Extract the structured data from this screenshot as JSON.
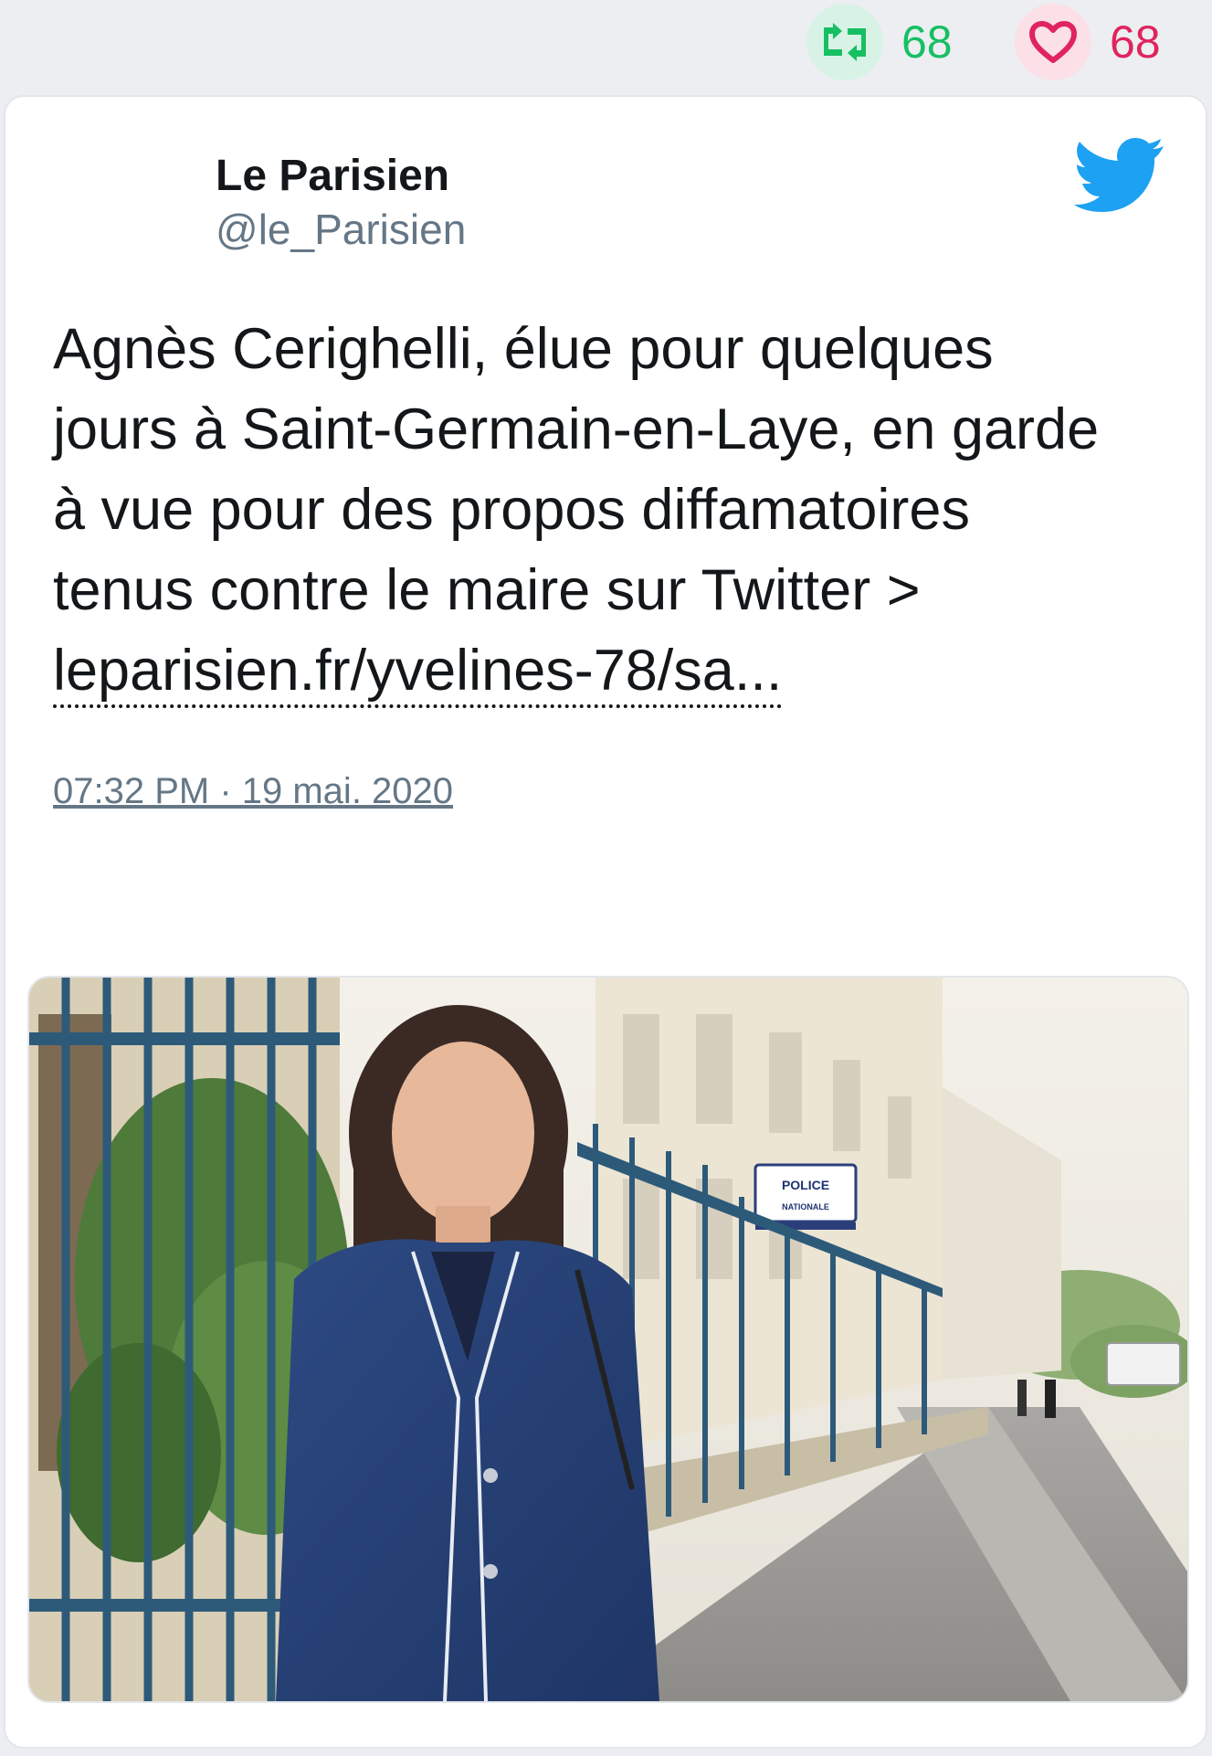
{
  "stats": {
    "retweets": "68",
    "likes": "68"
  },
  "author": {
    "name": "Le Parisien",
    "handle": "@le_Parisien"
  },
  "tweet": {
    "text_lines": [
      "Agnès Cerighelli, élue pour quelques",
      "jours à Saint-Germain-en-Laye, en garde",
      "à vue pour des propos diffamatoires",
      "tenus contre le maire sur Twitter >"
    ],
    "link": "leparisien.fr/yvelines-78/sa...",
    "timestamp": "07:32 PM · 19 mai. 2020"
  },
  "media": {
    "sign_line1": "POLICE",
    "sign_line2": "NATIONALE"
  },
  "icons": {
    "retweet": "retweet-icon",
    "like": "heart-icon",
    "reply": "reply-icon",
    "brand": "twitter-bird-icon"
  },
  "colors": {
    "retweet": "#17bf63",
    "like": "#e0245e",
    "twitter_blue": "#1da1f2",
    "secondary_text": "#657786"
  }
}
